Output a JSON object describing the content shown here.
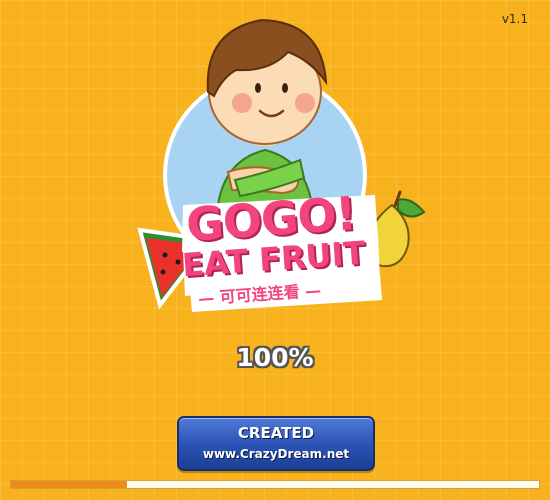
{
  "version": "v1.1",
  "logo": {
    "line1": "GOGO!",
    "line2": "EAT FRUIT",
    "subtitle": "— 可可连连看 —"
  },
  "loading": {
    "percent_text": "100%",
    "progress_fraction": 0.22
  },
  "credit_button": {
    "line1": "CREATED",
    "line2": "www.CrazyDream.net"
  },
  "colors": {
    "background": "#f8b21e",
    "logo_pink": "#f2457f",
    "button_blue": "#2b54b6",
    "progress_orange": "#f08b16"
  }
}
